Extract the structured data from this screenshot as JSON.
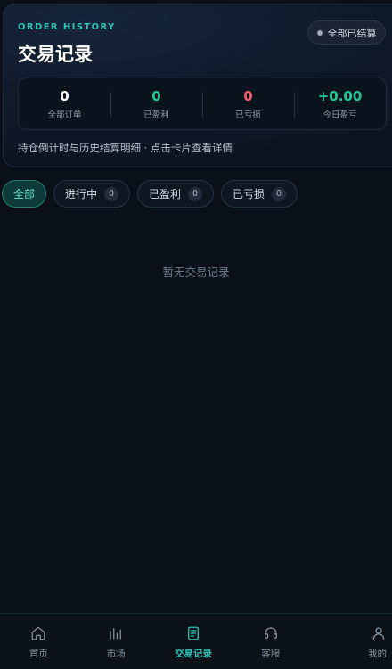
{
  "header": {
    "eyebrow": "ORDER HISTORY",
    "title": "交易记录",
    "settle_label": "全部已结算",
    "hint": "持仓倒计时与历史结算明细 · 点击卡片查看详情"
  },
  "stats": [
    {
      "value": "0",
      "label": "全部订单",
      "color": "#ffffff"
    },
    {
      "value": "0",
      "label": "已盈利",
      "color": "#22c997"
    },
    {
      "value": "0",
      "label": "已亏损",
      "color": "#ef5f6b"
    },
    {
      "value": "+0.00",
      "label": "今日盈亏",
      "color": "#22c997"
    }
  ],
  "filters": [
    {
      "label": "全部",
      "active": true
    },
    {
      "label": "进行中",
      "count": "0"
    },
    {
      "label": "已盈利",
      "count": "0"
    },
    {
      "label": "已亏损",
      "count": "0"
    }
  ],
  "empty_text": "暂无交易记录",
  "tabbar": [
    {
      "label": "首页",
      "icon": "home-icon"
    },
    {
      "label": "市场",
      "icon": "market-chart-icon"
    },
    {
      "label": "交易记录",
      "icon": "document-icon",
      "active": true
    },
    {
      "label": "客服",
      "icon": "headset-icon"
    },
    {
      "label": "我的",
      "icon": "user-icon"
    }
  ],
  "colors": {
    "accent": "#2ec4b6",
    "profit": "#22c997",
    "loss": "#ef5f6b",
    "background": "#0a0f19"
  }
}
